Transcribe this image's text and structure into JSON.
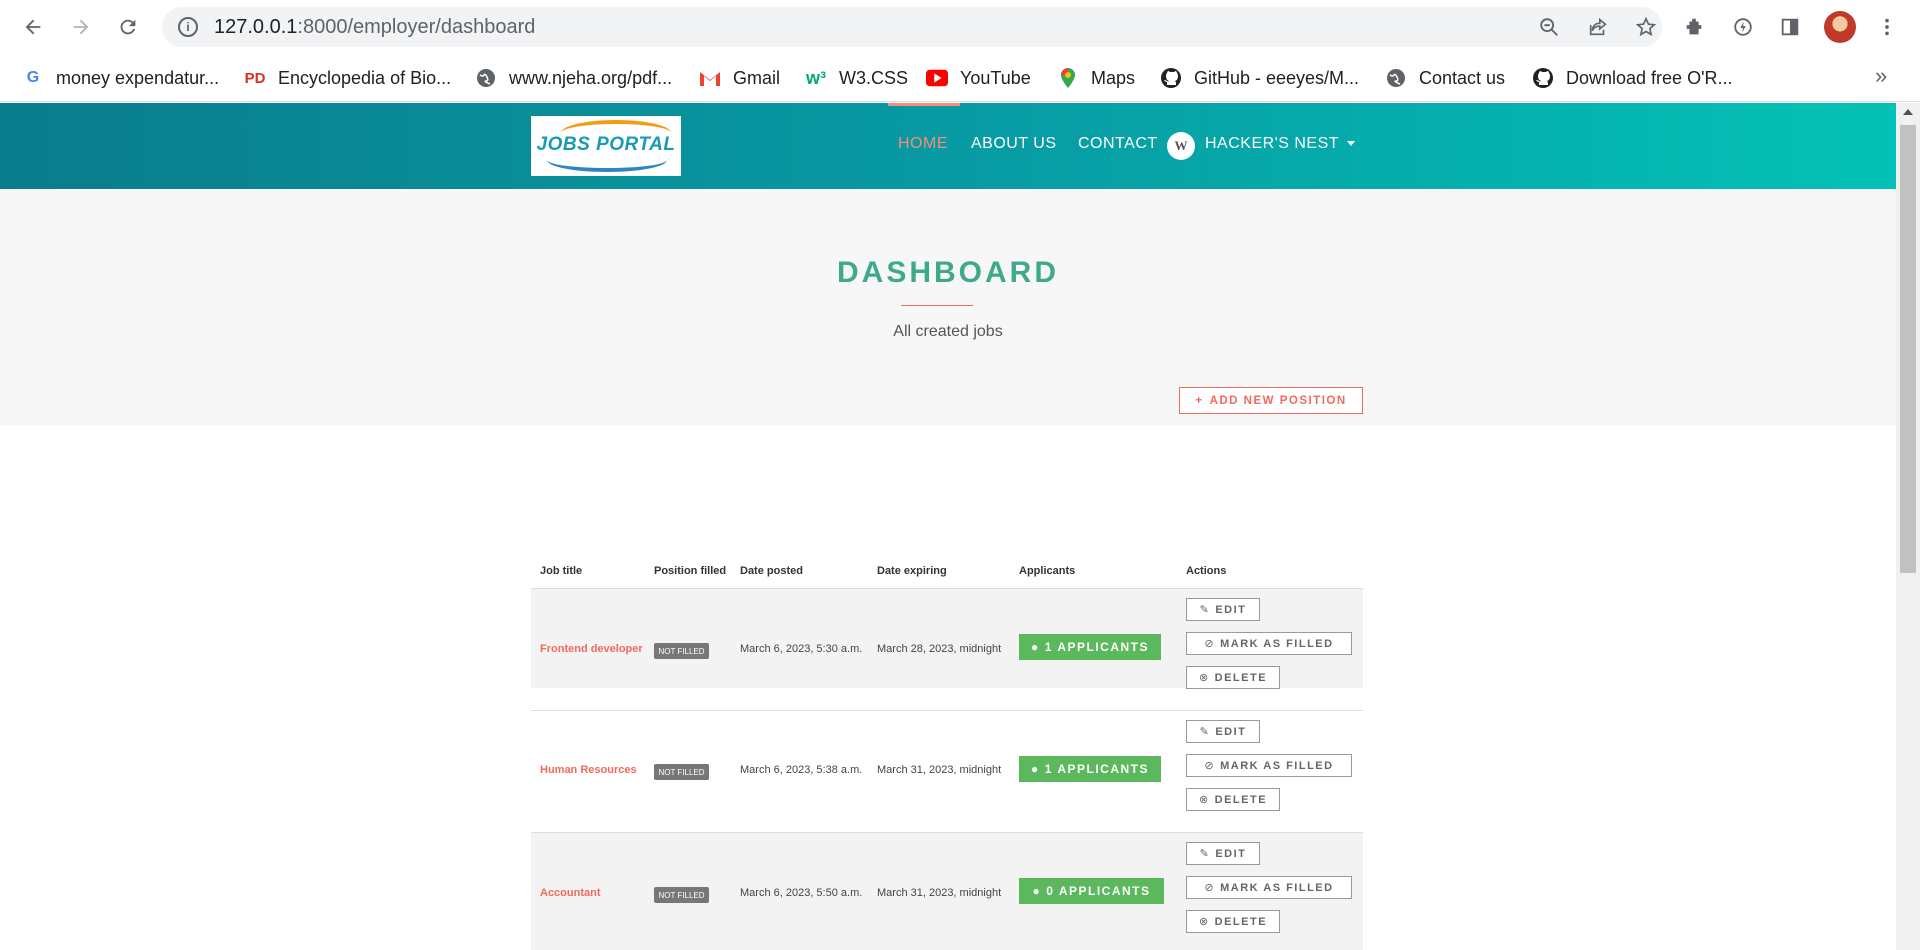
{
  "browser": {
    "url_host": "127.0.0.1",
    "url_path": ":8000/employer/dashboard",
    "bookmarks": [
      {
        "label": "money expendatur...",
        "icon": "google-icon",
        "color": "#4285f4"
      },
      {
        "label": "Encyclopedia of Bio...",
        "icon": "pd-icon",
        "color": "#d93025"
      },
      {
        "label": "www.njeha.org/pdf...",
        "icon": "globe-icon",
        "color": "#5f6368"
      },
      {
        "label": "Gmail",
        "icon": "gmail-icon",
        "color": "#ea4335"
      },
      {
        "label": "W3.CSS",
        "icon": "w3-icon",
        "color": "#04aa6d"
      },
      {
        "label": "YouTube",
        "icon": "youtube-icon",
        "color": "#ff0000"
      },
      {
        "label": "Maps",
        "icon": "maps-icon",
        "color": "#34a853"
      },
      {
        "label": "GitHub - eeeyes/M...",
        "icon": "github-icon",
        "color": "#202124"
      },
      {
        "label": "Contact us",
        "icon": "globe-icon",
        "color": "#5f6368"
      },
      {
        "label": "Download free O'R...",
        "icon": "github-icon",
        "color": "#202124"
      }
    ],
    "more": "»"
  },
  "site": {
    "logo_text": "JOBS PORTAL",
    "nav": {
      "home": "HOME",
      "about": "ABOUT US",
      "contact": "CONTACT",
      "user": "HACKER'S NEST"
    },
    "accent": "#f58c7e"
  },
  "hero": {
    "title": "DASHBOARD",
    "subtitle": "All created jobs"
  },
  "add_button": "ADD NEW POSITION",
  "table": {
    "headers": [
      "Job title",
      "Position filled",
      "Date posted",
      "Date expiring",
      "Applicants",
      "Actions"
    ],
    "rows": [
      {
        "title": "Frontend developer",
        "status": "NOT FILLED",
        "posted": "March 6, 2023, 5:30 a.m.",
        "expiring": "March 28, 2023, midnight",
        "applicants": "1 APPLICANTS"
      },
      {
        "title": "Human Resources",
        "status": "NOT FILLED",
        "posted": "March 6, 2023, 5:38 a.m.",
        "expiring": "March 31, 2023, midnight",
        "applicants": "1 APPLICANTS"
      },
      {
        "title": "Accountant",
        "status": "NOT FILLED",
        "posted": "March 6, 2023, 5:50 a.m.",
        "expiring": "March 31, 2023, midnight",
        "applicants": "0 APPLICANTS"
      }
    ],
    "actions": {
      "edit": "EDIT",
      "mark": "MARK AS FILLED",
      "delete": "DELETE"
    }
  }
}
